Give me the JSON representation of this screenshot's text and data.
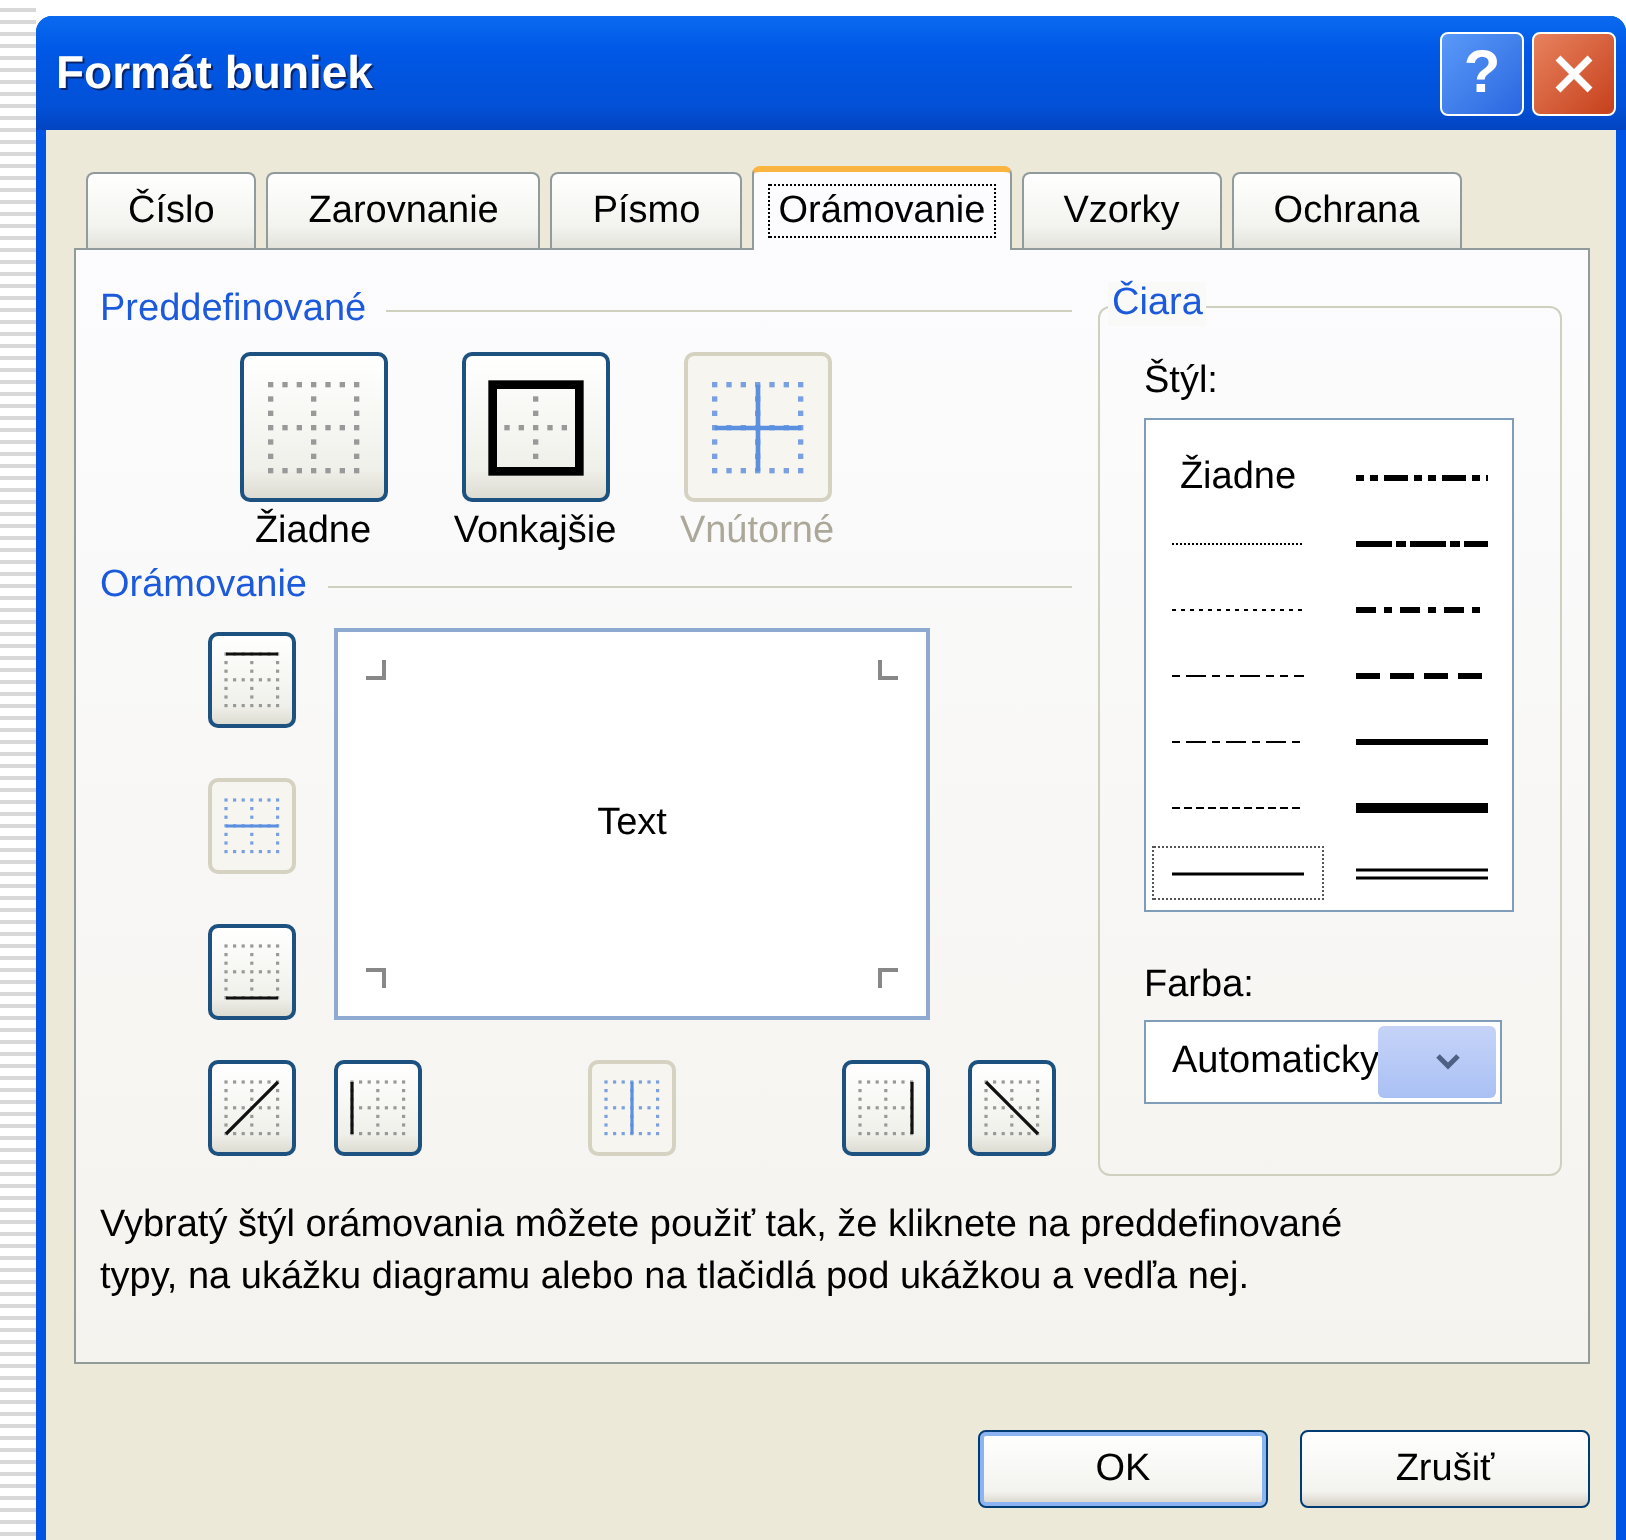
{
  "window": {
    "title": "Formát buniek"
  },
  "title_buttons": [
    {
      "kind": "help",
      "label": "?"
    },
    {
      "kind": "close"
    }
  ],
  "tabs": [
    {
      "label": "Číslo",
      "selected": false
    },
    {
      "label": "Zarovnanie",
      "selected": false
    },
    {
      "label": "Písmo",
      "selected": false
    },
    {
      "label": "Orámovanie",
      "selected": true
    },
    {
      "label": "Vzorky",
      "selected": false
    },
    {
      "label": "Ochrana",
      "selected": false
    }
  ],
  "presets": {
    "heading": "Preddefinované",
    "items": [
      {
        "kind": "none",
        "label": "Žiadne",
        "disabled": false
      },
      {
        "kind": "outline",
        "label": "Vonkajšie",
        "disabled": false
      },
      {
        "kind": "inside",
        "label": "Vnútorné",
        "disabled": true
      }
    ]
  },
  "border": {
    "heading": "Orámovanie",
    "preview_text": "Text",
    "buttons": [
      {
        "kind": "top",
        "disabled": false
      },
      {
        "kind": "inside-h",
        "disabled": true
      },
      {
        "kind": "bottom",
        "disabled": false
      },
      {
        "kind": "diag-up",
        "disabled": false
      },
      {
        "kind": "left",
        "disabled": false
      },
      {
        "kind": "inside-v",
        "disabled": true
      },
      {
        "kind": "right",
        "disabled": false
      },
      {
        "kind": "diag-down",
        "disabled": false
      }
    ]
  },
  "line": {
    "heading": "Čiara",
    "style_label": "Štýl:",
    "styles": [
      {
        "kind": "none",
        "label": "Žiadne",
        "selected": false
      },
      {
        "kind": "hair",
        "selected": false
      },
      {
        "kind": "dotted",
        "selected": false
      },
      {
        "kind": "dash-dot-dot",
        "selected": false
      },
      {
        "kind": "dash-dot",
        "selected": false
      },
      {
        "kind": "dashed",
        "selected": false
      },
      {
        "kind": "thin",
        "selected": true
      },
      {
        "kind": "medium-dash-dot-dot",
        "selected": false
      },
      {
        "kind": "slant-dash-dot",
        "selected": false
      },
      {
        "kind": "medium-dash-dot",
        "selected": false
      },
      {
        "kind": "medium-dashed",
        "selected": false
      },
      {
        "kind": "medium",
        "selected": false
      },
      {
        "kind": "thick",
        "selected": false
      },
      {
        "kind": "double",
        "selected": false
      }
    ],
    "color_label": "Farba:",
    "color_value": "Automaticky"
  },
  "description": "Vybratý štýl orámovania môžete použiť tak, že kliknete na preddefinované typy, na ukážku diagramu alebo na tlačidlá pod ukážkou a vedľa nej.",
  "buttons": [
    {
      "label": "OK",
      "default": true
    },
    {
      "label": "Zrušiť",
      "default": false
    }
  ]
}
